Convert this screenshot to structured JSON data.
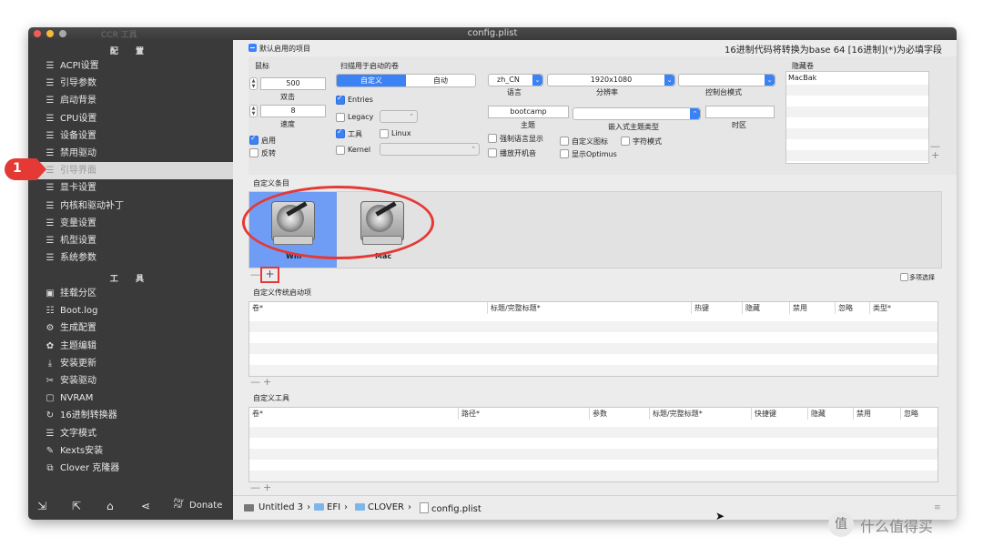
{
  "window": {
    "title": "config.plist",
    "faded_title": "CCR 工具"
  },
  "sidebar": {
    "config_heading": "配 置",
    "tools_heading": "工 具",
    "config_items": [
      {
        "icon": "list-icon",
        "label": "ACPI设置"
      },
      {
        "icon": "list-icon",
        "label": "引导参数"
      },
      {
        "icon": "list-icon",
        "label": "启动背景"
      },
      {
        "icon": "list-icon",
        "label": "CPU设置"
      },
      {
        "icon": "list-icon",
        "label": "设备设置"
      },
      {
        "icon": "list-icon",
        "label": "禁用驱动"
      },
      {
        "icon": "list-icon",
        "label": "引导界面"
      },
      {
        "icon": "list-icon",
        "label": "显卡设置"
      },
      {
        "icon": "list-icon",
        "label": "内核和驱动补丁"
      },
      {
        "icon": "list-icon",
        "label": "变量设置"
      },
      {
        "icon": "list-icon",
        "label": "机型设置"
      },
      {
        "icon": "list-icon",
        "label": "系统参数"
      }
    ],
    "selected_index": 6,
    "tool_items": [
      {
        "icon": "disk-icon",
        "label": "挂载分区"
      },
      {
        "icon": "log-icon",
        "label": "Boot.log"
      },
      {
        "icon": "gears-icon",
        "label": "生成配置"
      },
      {
        "icon": "palette-icon",
        "label": "主题编辑"
      },
      {
        "icon": "download-icon",
        "label": "安装更新"
      },
      {
        "icon": "tools-icon",
        "label": "安装驱动"
      },
      {
        "icon": "chip-icon",
        "label": "NVRAM"
      },
      {
        "icon": "convert-icon",
        "label": "16进制转换器"
      },
      {
        "icon": "text-icon",
        "label": "文字模式"
      },
      {
        "icon": "brush-icon",
        "label": "Kexts安装"
      },
      {
        "icon": "copy-icon",
        "label": "Clover 克隆器"
      }
    ],
    "bottom": {
      "donate": "Donate",
      "paypal_top": "Pay",
      "paypal_bottom": "Pal"
    }
  },
  "annotation": {
    "marker": "1"
  },
  "main": {
    "default_boot_label": "默认启用的项目",
    "hex_hint": "16进制代码将转换为base 64 [16进制](*)为必填字段",
    "mouse": {
      "heading": "鼠标",
      "speed_value": "500",
      "double_click_label": "双击",
      "double_value": "8",
      "speed_label": "速度",
      "enabled_label": "启用",
      "enabled": true,
      "mirror_label": "反转",
      "mirror": false
    },
    "scan": {
      "heading": "扫描用于启动的卷",
      "custom": "自定义",
      "auto": "自动",
      "entries": "Entries",
      "legacy": "Legacy",
      "tool": "工具",
      "linux": "Linux",
      "kernel": "Kernel"
    },
    "language": {
      "value": "zh_CN",
      "label": "语言"
    },
    "resolution": {
      "value": "1920x1080",
      "label": "分辨率"
    },
    "console": {
      "value": "",
      "label": "控制台模式"
    },
    "theme": {
      "value": "bootcamp",
      "label": "主题"
    },
    "embedded_theme": {
      "value": "",
      "label": "嵌入式主题类型"
    },
    "timeout": {
      "value": "",
      "label": "时区"
    },
    "force_lang": "强制语言显示",
    "custom_icons": "自定义图标",
    "char_mode": "字符模式",
    "play_async": "播放开机音",
    "show_optimus": "显示Optimus",
    "hidden_volumes": {
      "heading": "隐藏卷",
      "items": [
        "MacBak"
      ]
    },
    "custom_entries": {
      "heading": "自定义条目",
      "items": [
        {
          "label": "Win"
        },
        {
          "label": "Mac"
        }
      ],
      "multi_select": "多项选择"
    },
    "legacy_entries": {
      "heading": "自定义传统启动项",
      "columns": [
        "卷*",
        "标题/完整标题*",
        "热键",
        "隐藏",
        "禁用",
        "忽略",
        "类型*"
      ]
    },
    "custom_tools": {
      "heading": "自定义工具",
      "columns": [
        "卷*",
        "路径*",
        "参数",
        "标题/完整标题*",
        "快捷键",
        "隐藏",
        "禁用",
        "忽略"
      ]
    },
    "breadcrumb": [
      "Untitled 3",
      "EFI",
      "CLOVER",
      "config.plist"
    ]
  },
  "watermark": {
    "glyph": "值",
    "text": "什么值得买"
  },
  "colors": {
    "accent": "#3b82f6",
    "sidebar_bg": "#3a3a3a",
    "highlight_red": "#e53935"
  }
}
